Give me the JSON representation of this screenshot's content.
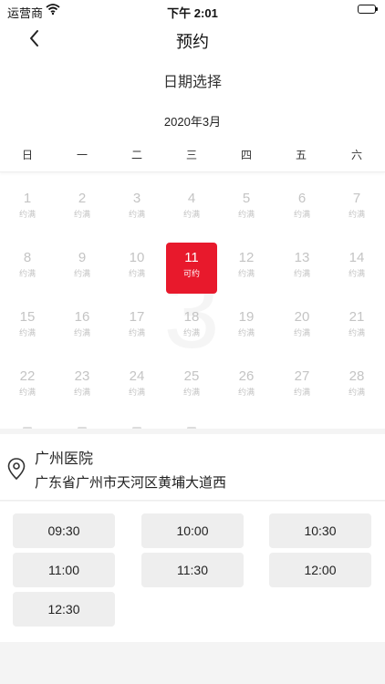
{
  "status_bar": {
    "carrier": "运营商",
    "time": "下午 2:01"
  },
  "nav": {
    "title": "预约"
  },
  "calendar": {
    "section_title": "日期选择",
    "month": "2020年3月",
    "weekdays": [
      "日",
      "一",
      "二",
      "三",
      "四",
      "五",
      "六"
    ],
    "watermark": "3",
    "selected_day": 11,
    "days": [
      {
        "day": "1",
        "status": "约满"
      },
      {
        "day": "2",
        "status": "约满"
      },
      {
        "day": "3",
        "status": "约满"
      },
      {
        "day": "4",
        "status": "约满"
      },
      {
        "day": "5",
        "status": "约满"
      },
      {
        "day": "6",
        "status": "约满"
      },
      {
        "day": "7",
        "status": "约满"
      },
      {
        "day": "8",
        "status": "约满"
      },
      {
        "day": "9",
        "status": "约满"
      },
      {
        "day": "10",
        "status": "约满"
      },
      {
        "day": "11",
        "status": "可约"
      },
      {
        "day": "12",
        "status": "约满"
      },
      {
        "day": "13",
        "status": "约满"
      },
      {
        "day": "14",
        "status": "约满"
      },
      {
        "day": "15",
        "status": "约满"
      },
      {
        "day": "16",
        "status": "约满"
      },
      {
        "day": "17",
        "status": "约满"
      },
      {
        "day": "18",
        "status": "约满"
      },
      {
        "day": "19",
        "status": "约满"
      },
      {
        "day": "20",
        "status": "约满"
      },
      {
        "day": "21",
        "status": "约满"
      },
      {
        "day": "22",
        "status": "约满"
      },
      {
        "day": "23",
        "status": "约满"
      },
      {
        "day": "24",
        "status": "约满"
      },
      {
        "day": "25",
        "status": "约满"
      },
      {
        "day": "26",
        "status": "约满"
      },
      {
        "day": "27",
        "status": "约满"
      },
      {
        "day": "28",
        "status": "约满"
      }
    ]
  },
  "location": {
    "name": "广州医院",
    "address": "广东省广州市天河区黄埔大道西",
    "icon": "location-pin-icon"
  },
  "time_slots": [
    "09:30",
    "10:00",
    "10:30",
    "11:00",
    "11:30",
    "12:00",
    "12:30"
  ],
  "colors": {
    "accent": "#e8192c",
    "disabled_text": "#c4c4c4",
    "slot_bg": "#eeeeee"
  }
}
